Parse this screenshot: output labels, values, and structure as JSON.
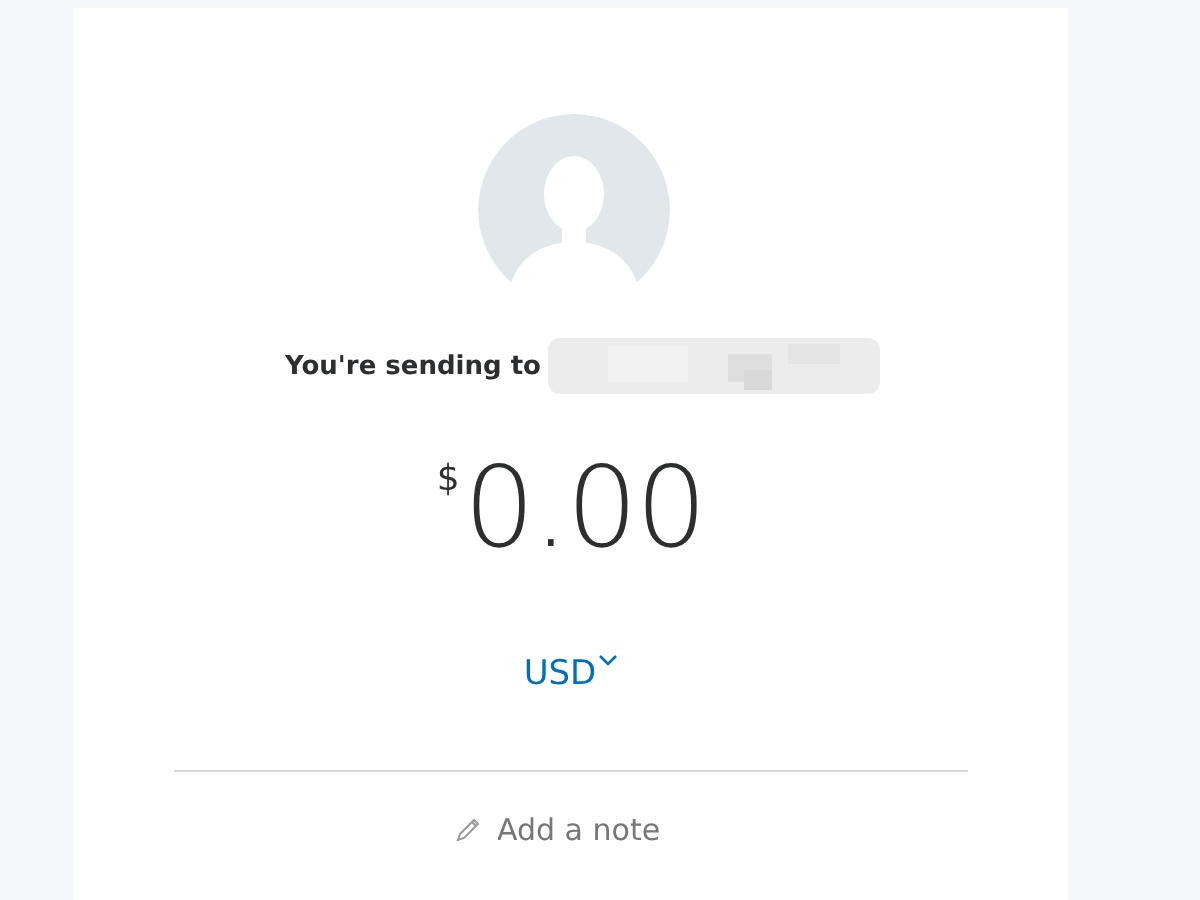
{
  "recipient": {
    "label": "You're sending to"
  },
  "amount": {
    "currency_symbol": "$",
    "value": "0.00"
  },
  "currency": {
    "code": "USD"
  },
  "note": {
    "placeholder": "Add a note"
  }
}
